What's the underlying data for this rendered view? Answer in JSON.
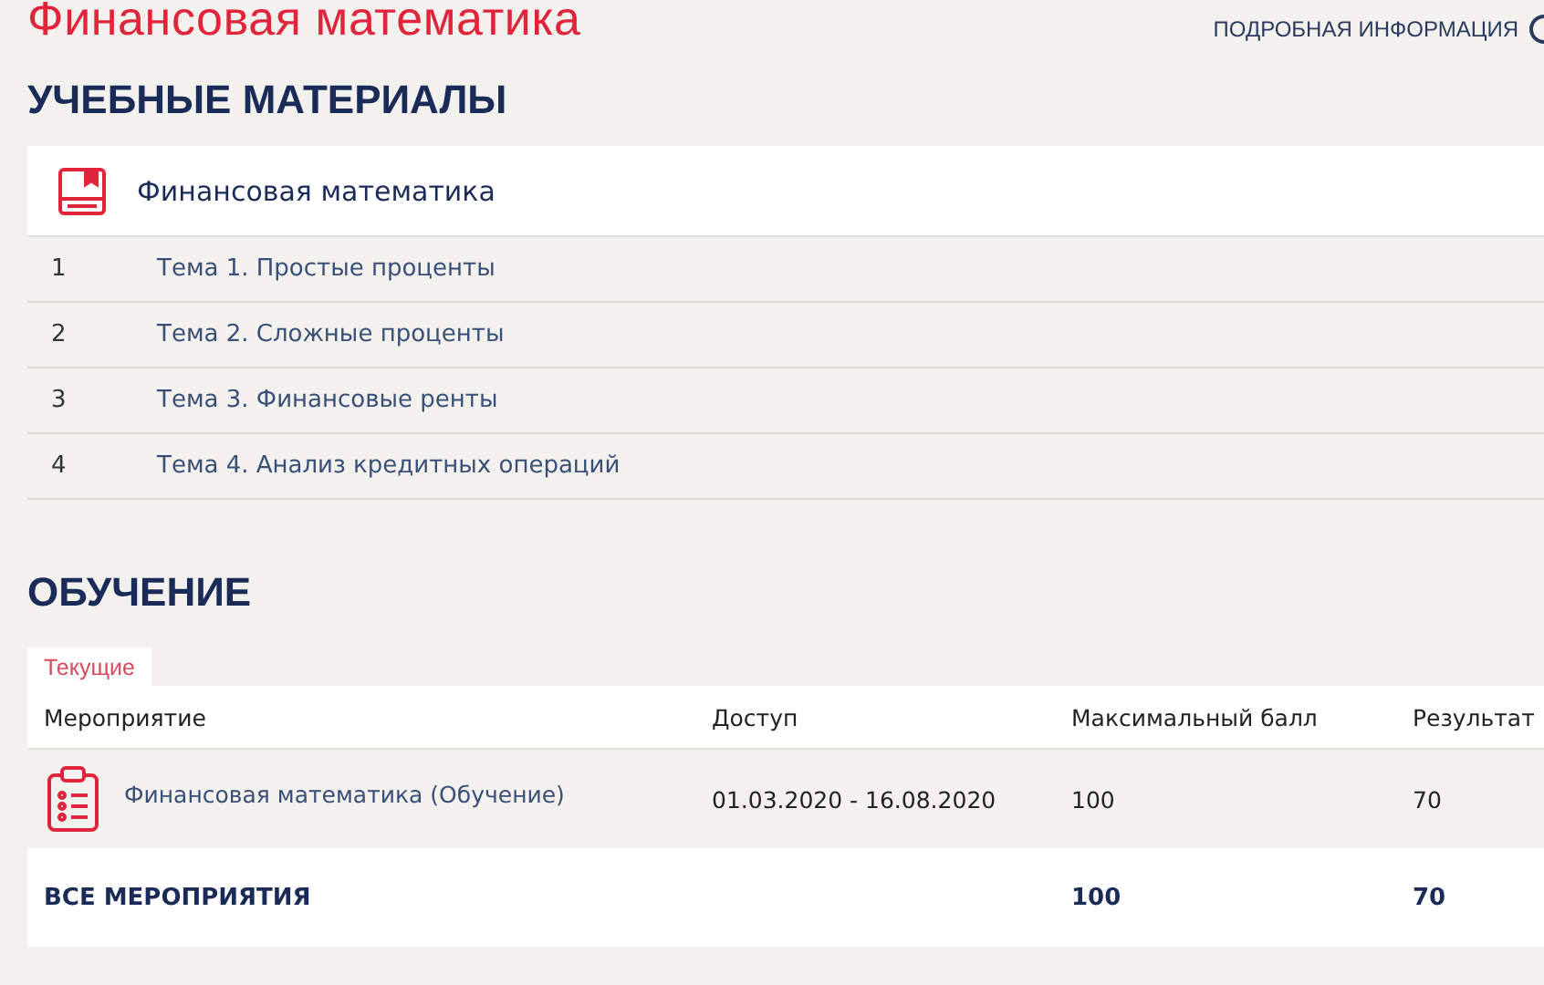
{
  "page_title": "Финансовая математика",
  "header_link": "ПОДРОБНАЯ ИНФОРМАЦИЯ",
  "materials": {
    "heading": "УЧЕБНЫЕ МАТЕРИАЛЫ",
    "course": "Финансовая математика",
    "topics": [
      {
        "number": "1",
        "title": "Тема 1. Простые проценты"
      },
      {
        "number": "2",
        "title": "Тема 2. Сложные проценты"
      },
      {
        "number": "3",
        "title": "Тема 3. Финансовые ренты"
      },
      {
        "number": "4",
        "title": "Тема 4. Анализ кредитных операций"
      }
    ]
  },
  "learning": {
    "heading": "ОБУЧЕНИЕ",
    "tabs": [
      {
        "label": "Текущие",
        "selected": true
      }
    ],
    "table": {
      "columns": [
        "Мероприятие",
        "Доступ",
        "Максимальный балл",
        "Результат"
      ],
      "rows": [
        [
          "Финансовая математика (Обучение)",
          "01.03.2020 - 16.08.2020",
          "100",
          "70"
        ]
      ],
      "total": {
        "label": "ВСЕ МЕРОПРИЯТИЯ",
        "max_score": "100",
        "result": "70"
      }
    }
  }
}
